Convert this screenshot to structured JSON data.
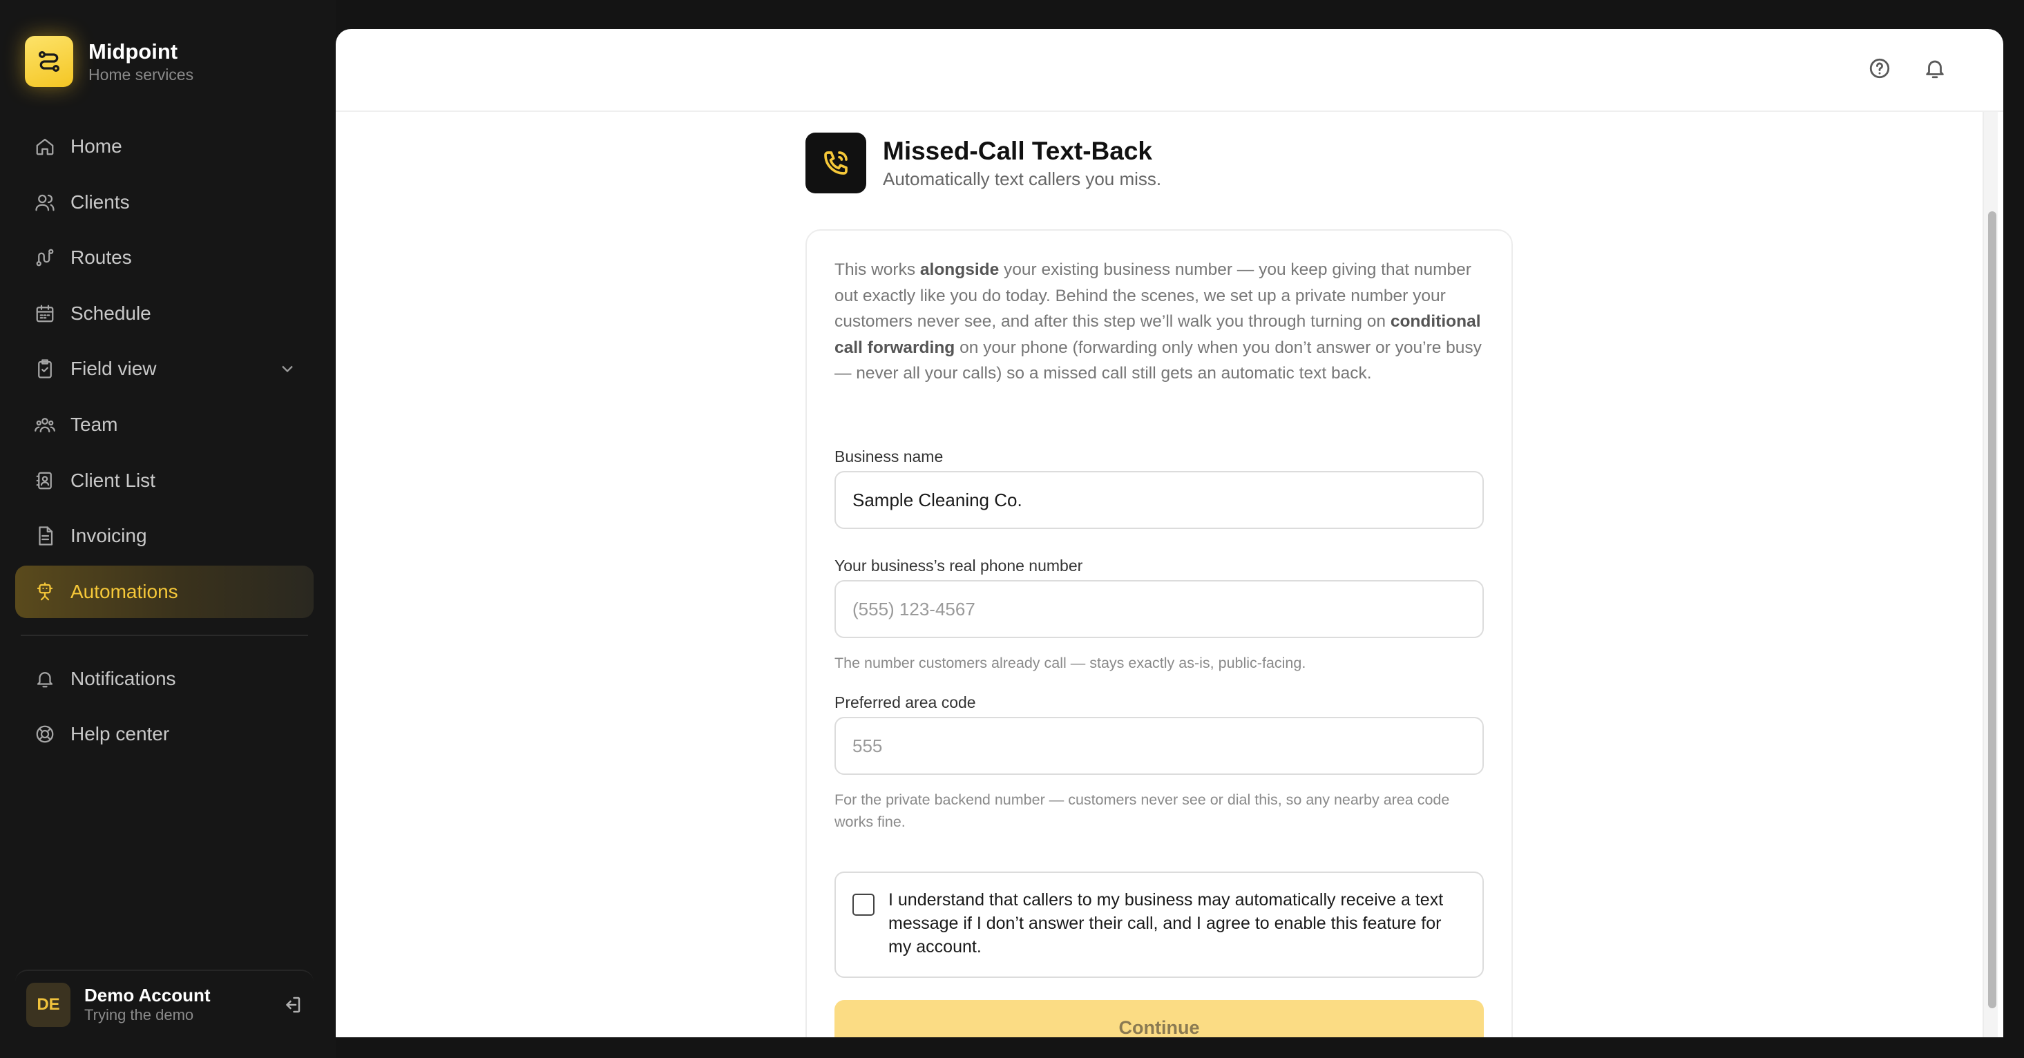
{
  "brand": {
    "name": "Midpoint",
    "subtitle": "Home services",
    "logo_icon": "route-icon",
    "accent": "#f6c839"
  },
  "sidebar": {
    "items": [
      {
        "label": "Home",
        "icon": "home-icon"
      },
      {
        "label": "Clients",
        "icon": "users-icon"
      },
      {
        "label": "Routes",
        "icon": "route-icon"
      },
      {
        "label": "Schedule",
        "icon": "calendar-icon"
      },
      {
        "label": "Field view",
        "icon": "clipboard-icon",
        "expandable": true
      },
      {
        "label": "Team",
        "icon": "team-icon"
      },
      {
        "label": "Client List",
        "icon": "contact-book-icon"
      },
      {
        "label": "Invoicing",
        "icon": "invoice-icon"
      },
      {
        "label": "Automations",
        "icon": "automation-icon",
        "active": true
      }
    ],
    "secondary_items": [
      {
        "label": "Notifications",
        "icon": "bell-icon"
      },
      {
        "label": "Help center",
        "icon": "lifebuoy-icon"
      }
    ]
  },
  "account": {
    "initials": "DE",
    "name": "Demo Account",
    "subtitle": "Trying the demo"
  },
  "topbar": {
    "icons": [
      "help-icon",
      "bell-icon"
    ]
  },
  "page": {
    "title": "Missed-Call Text-Back",
    "subtitle": "Automatically text callers you miss.",
    "icon": "phone-icon"
  },
  "intro": {
    "p1": "This works ",
    "b1": "alongside",
    "p2": " your existing business number — you keep giving that number out exactly like you do today. Behind the scenes, we set up a private number your customers never see, and after this step we’ll walk you through turning on ",
    "b2": "conditional call forwarding",
    "p3": " on your phone (forwarding only when you don’t answer or you’re busy — never all your calls) so a missed call still gets an automatic text back."
  },
  "form": {
    "business_name": {
      "label": "Business name",
      "value": "Sample Cleaning Co."
    },
    "phone": {
      "label": "Your business’s real phone number",
      "placeholder": "(555) 123-4567",
      "hint": "The number customers already call — stays exactly as-is, public-facing."
    },
    "area_code": {
      "label": "Preferred area code",
      "placeholder": "555",
      "hint": "For the private backend number — customers never see or dial this, so any nearby area code works fine."
    },
    "consent": {
      "text": "I understand that callers to my business may automatically receive a text message if I don’t answer their call, and I agree to enable this feature for my account.",
      "checked": false
    },
    "continue_label": "Continue"
  }
}
